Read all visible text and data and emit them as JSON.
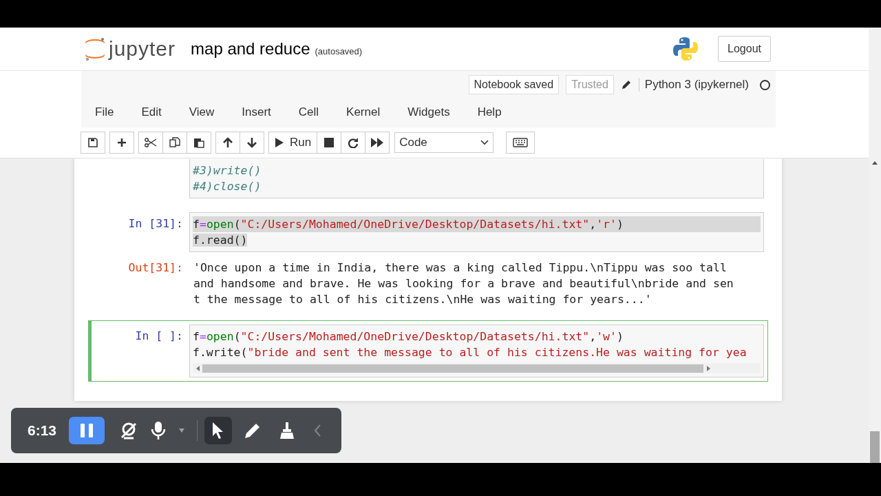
{
  "header": {
    "logo": "jupyter",
    "title": "map and reduce",
    "autosave": "(autosaved)",
    "logout": "Logout"
  },
  "status": {
    "saved": "Notebook saved",
    "trusted": "Trusted",
    "kernel": "Python 3 (ipykernel)",
    "kernel_busy": false
  },
  "menu": [
    "File",
    "Edit",
    "View",
    "Insert",
    "Cell",
    "Kernel",
    "Widgets",
    "Help"
  ],
  "toolbar": {
    "run": "Run",
    "cell_type": "Code"
  },
  "cells": [
    {
      "selected": false,
      "lines": [
        [
          {
            "t": "#3)write()",
            "kind": "comment"
          }
        ],
        [
          {
            "t": "#4)close()",
            "kind": "comment"
          }
        ]
      ]
    },
    {
      "prompt": "In [31]:",
      "selected": false,
      "lines": [
        [
          {
            "t": "f",
            "kind": "plain"
          },
          {
            "t": "=",
            "kind": "op"
          },
          {
            "t": "open",
            "kind": "builtin"
          },
          {
            "t": "(",
            "kind": "plain"
          },
          {
            "t": "\"C:/Users/Mohamed/OneDrive/Desktop/Datasets/hi.txt\"",
            "kind": "string"
          },
          {
            "t": ",",
            "kind": "plain"
          },
          {
            "t": "'r'",
            "kind": "string"
          },
          {
            "t": ")",
            "kind": "plain"
          }
        ],
        [
          {
            "t": "f.read()",
            "kind": "plain"
          }
        ]
      ],
      "highlighted": true,
      "out_prompt": "Out[31]:",
      "output": [
        "'Once upon a time in India, there was a king called Tippu.\\nTippu was soo tall",
        "and handsome and brave. He was looking for a brave and beautiful\\nbride and sen",
        "t the message to all of his citizens.\\nHe was waiting for years...'"
      ]
    },
    {
      "prompt": "In [ ]:",
      "selected": true,
      "scrollbar": true,
      "lines": [
        [
          {
            "t": "f",
            "kind": "plain"
          },
          {
            "t": "=",
            "kind": "op"
          },
          {
            "t": "open",
            "kind": "builtin"
          },
          {
            "t": "(",
            "kind": "plain"
          },
          {
            "t": "\"C:/Users/Mohamed/OneDrive/Desktop/Datasets/hi.txt\"",
            "kind": "string"
          },
          {
            "t": ",",
            "kind": "plain"
          },
          {
            "t": "'w'",
            "kind": "string"
          },
          {
            "t": ")",
            "kind": "plain"
          }
        ],
        [
          {
            "t": "f.write(",
            "kind": "plain"
          },
          {
            "t": "\"bride and sent the message to all of his citizens.He was waiting for yea",
            "kind": "string"
          }
        ]
      ]
    }
  ],
  "recorder": {
    "time": "6:13",
    "tools": [
      {
        "kind": "pointer",
        "selected": true
      },
      {
        "kind": "pen",
        "selected": false
      },
      {
        "kind": "eraser",
        "selected": false
      }
    ]
  }
}
